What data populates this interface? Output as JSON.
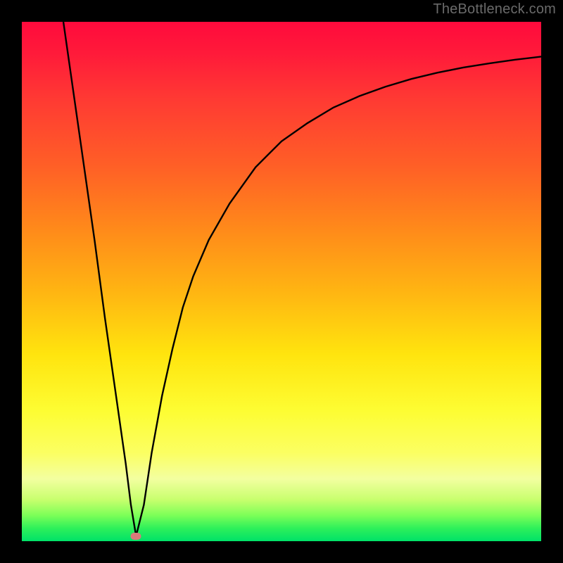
{
  "watermark": "TheBottleneck.com",
  "chart_data": {
    "type": "line",
    "title": "",
    "xlabel": "",
    "ylabel": "",
    "xlim": [
      0,
      100
    ],
    "ylim": [
      0,
      100
    ],
    "grid": false,
    "gradient": {
      "top_color": "#ff0a3c",
      "bottom_color": "#00e268",
      "description": "red-to-green vertical"
    },
    "marker": {
      "x": 22,
      "y": 1,
      "color": "#d97a7a"
    },
    "series": [
      {
        "name": "bottleneck-curve",
        "color": "#000000",
        "x": [
          8,
          10,
          12,
          14,
          16,
          18,
          20,
          21,
          22,
          23.5,
          25,
          27,
          29,
          31,
          33,
          36,
          40,
          45,
          50,
          55,
          60,
          65,
          70,
          75,
          80,
          85,
          90,
          95,
          100
        ],
        "y": [
          100,
          86,
          72,
          58,
          43,
          29,
          15,
          7,
          1,
          7,
          17,
          28,
          37,
          45,
          51,
          58,
          65,
          72,
          77,
          80.5,
          83.5,
          85.7,
          87.5,
          89,
          90.2,
          91.2,
          92,
          92.7,
          93.3
        ]
      }
    ]
  }
}
